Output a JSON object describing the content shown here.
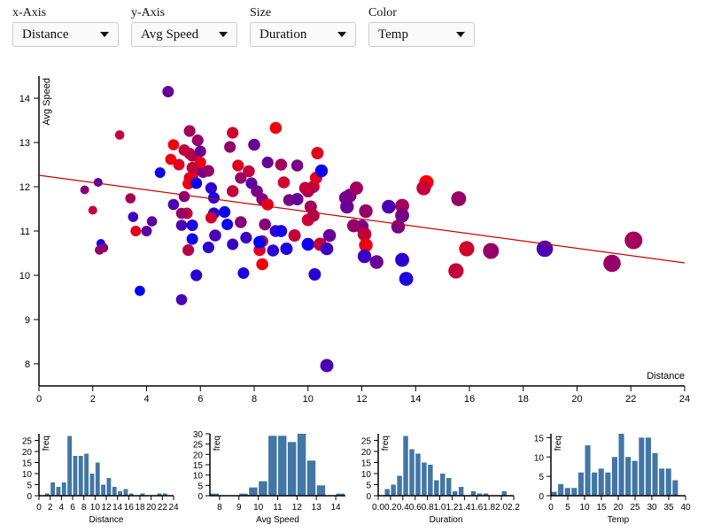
{
  "controls": [
    {
      "label": "x-Axis",
      "value": "Distance"
    },
    {
      "label": "y-Axis",
      "value": "Avg Speed"
    },
    {
      "label": "Size",
      "value": "Duration"
    },
    {
      "label": "Color",
      "value": "Temp"
    }
  ],
  "colors": {
    "cold": "#0000ff",
    "hot": "#ff0000",
    "regression": "#cc0000",
    "bar": "#4176a5",
    "axis": "#000000"
  },
  "chart_data": [
    {
      "type": "scatter",
      "title": "",
      "xlabel": "Distance",
      "ylabel": "Avg Speed",
      "xlim": [
        0,
        24
      ],
      "ylim": [
        7.5,
        14.5
      ],
      "xticks": [
        0,
        2,
        4,
        6,
        8,
        10,
        12,
        14,
        16,
        18,
        20,
        22,
        24
      ],
      "yticks": [
        8,
        9,
        10,
        11,
        12,
        13,
        14
      ],
      "size_field": "Duration",
      "color_field": "Temp",
      "regression": {
        "x": [
          0,
          24
        ],
        "y": [
          12.26,
          10.28
        ]
      },
      "points": [
        [
          4.8,
          14.15,
          0.5,
          18
        ],
        [
          3.0,
          13.17,
          0.25,
          30
        ],
        [
          1.7,
          11.93,
          0.2,
          22
        ],
        [
          2.0,
          11.47,
          0.2,
          30
        ],
        [
          2.2,
          12.1,
          0.2,
          14
        ],
        [
          2.3,
          10.72,
          0.2,
          6
        ],
        [
          2.25,
          10.57,
          0.25,
          24
        ],
        [
          2.4,
          10.62,
          0.25,
          22
        ],
        [
          3.6,
          11.0,
          0.4,
          34
        ],
        [
          4.0,
          11.0,
          0.4,
          16
        ],
        [
          3.4,
          11.74,
          0.35,
          26
        ],
        [
          4.2,
          11.22,
          0.35,
          16
        ],
        [
          3.5,
          11.32,
          0.35,
          12
        ],
        [
          3.75,
          9.65,
          0.35,
          4
        ],
        [
          5.3,
          9.45,
          0.45,
          14
        ],
        [
          4.5,
          12.32,
          0.4,
          6
        ],
        [
          5.0,
          12.95,
          0.45,
          36
        ],
        [
          4.9,
          12.62,
          0.45,
          36
        ],
        [
          5.6,
          12.75,
          0.55,
          30
        ],
        [
          5.6,
          13.26,
          0.55,
          26
        ],
        [
          5.4,
          12.83,
          0.5,
          30
        ],
        [
          5.7,
          12.7,
          0.55,
          28
        ],
        [
          6.0,
          12.8,
          0.5,
          18
        ],
        [
          5.9,
          13.05,
          0.55,
          24
        ],
        [
          6.0,
          12.38,
          0.55,
          20
        ],
        [
          6.1,
          12.33,
          0.5,
          20
        ],
        [
          5.2,
          12.5,
          0.5,
          34
        ],
        [
          5.6,
          12.2,
          0.55,
          32
        ],
        [
          5.7,
          12.23,
          0.55,
          34
        ],
        [
          5.55,
          12.07,
          0.5,
          36
        ],
        [
          5.4,
          11.78,
          0.45,
          22
        ],
        [
          6.3,
          12.36,
          0.55,
          24
        ],
        [
          5.85,
          12.08,
          0.5,
          6
        ],
        [
          6.4,
          11.97,
          0.55,
          10
        ],
        [
          5.5,
          11.4,
          0.5,
          30
        ],
        [
          5.7,
          11.13,
          0.5,
          8
        ],
        [
          5.3,
          11.13,
          0.45,
          14
        ],
        [
          5.7,
          10.82,
          0.5,
          6
        ],
        [
          6.3,
          10.63,
          0.55,
          10
        ],
        [
          6.55,
          10.9,
          0.6,
          14
        ],
        [
          5.85,
          10.0,
          0.55,
          10
        ],
        [
          5.55,
          10.57,
          0.55,
          28
        ],
        [
          5.0,
          11.6,
          0.45,
          14
        ],
        [
          5.3,
          11.4,
          0.45,
          24
        ],
        [
          6.5,
          11.4,
          0.55,
          10
        ],
        [
          7.0,
          11.15,
          0.5,
          6
        ],
        [
          6.9,
          11.43,
          0.55,
          6
        ],
        [
          7.5,
          11.2,
          0.6,
          22
        ],
        [
          7.7,
          10.85,
          0.55,
          12
        ],
        [
          7.2,
          10.7,
          0.5,
          12
        ],
        [
          7.6,
          10.05,
          0.5,
          8
        ],
        [
          6.5,
          11.75,
          0.5,
          8
        ],
        [
          7.2,
          11.9,
          0.6,
          30
        ],
        [
          7.5,
          12.2,
          0.55,
          24
        ],
        [
          7.9,
          12.08,
          0.55,
          16
        ],
        [
          8.1,
          11.9,
          0.6,
          20
        ],
        [
          8.3,
          11.72,
          0.6,
          22
        ],
        [
          7.4,
          12.48,
          0.55,
          34
        ],
        [
          7.8,
          12.35,
          0.6,
          30
        ],
        [
          8.5,
          12.55,
          0.55,
          18
        ],
        [
          8.0,
          12.95,
          0.6,
          18
        ],
        [
          7.2,
          13.22,
          0.55,
          32
        ],
        [
          8.8,
          13.33,
          0.6,
          36
        ],
        [
          9.0,
          12.5,
          0.6,
          26
        ],
        [
          9.6,
          12.48,
          0.6,
          20
        ],
        [
          9.1,
          12.1,
          0.6,
          32
        ],
        [
          8.5,
          11.6,
          0.6,
          34
        ],
        [
          9.3,
          11.7,
          0.6,
          20
        ],
        [
          9.6,
          11.72,
          0.65,
          18
        ],
        [
          8.4,
          11.15,
          0.6,
          22
        ],
        [
          8.8,
          11.0,
          0.6,
          10
        ],
        [
          9.0,
          11.0,
          0.6,
          20
        ],
        [
          9.5,
          10.9,
          0.65,
          30
        ],
        [
          10.0,
          11.25,
          0.65,
          32
        ],
        [
          10.1,
          11.55,
          0.65,
          26
        ],
        [
          10.2,
          12.0,
          0.65,
          30
        ],
        [
          10.3,
          12.2,
          0.65,
          34
        ],
        [
          10.5,
          12.36,
          0.7,
          6
        ],
        [
          10.35,
          12.76,
          0.65,
          34
        ],
        [
          10.0,
          11.9,
          0.65,
          26
        ],
        [
          8.3,
          10.25,
          0.6,
          36
        ],
        [
          8.2,
          10.57,
          0.6,
          34
        ],
        [
          8.3,
          10.77,
          0.6,
          30
        ],
        [
          8.2,
          10.75,
          0.65,
          4
        ],
        [
          9.2,
          10.6,
          0.65,
          8
        ],
        [
          8.7,
          10.56,
          0.6,
          10
        ],
        [
          9.0,
          11.0,
          0.6,
          6
        ],
        [
          10.25,
          10.02,
          0.65,
          10
        ],
        [
          10.0,
          10.7,
          0.7,
          6
        ],
        [
          10.45,
          10.7,
          0.8,
          30
        ],
        [
          10.7,
          10.6,
          0.75,
          12
        ],
        [
          10.8,
          10.9,
          0.75,
          18
        ],
        [
          10.7,
          7.96,
          0.8,
          14
        ],
        [
          11.4,
          11.75,
          0.8,
          20
        ],
        [
          11.45,
          11.55,
          0.85,
          18
        ],
        [
          11.55,
          11.8,
          0.85,
          20
        ],
        [
          11.8,
          11.97,
          0.8,
          26
        ],
        [
          12.15,
          11.45,
          0.85,
          24
        ],
        [
          12.0,
          11.1,
          0.85,
          20
        ],
        [
          12.1,
          10.93,
          0.9,
          30
        ],
        [
          12.15,
          10.68,
          0.85,
          36
        ],
        [
          12.1,
          10.43,
          0.85,
          12
        ],
        [
          12.55,
          10.3,
          0.85,
          18
        ],
        [
          13.0,
          11.55,
          0.9,
          14
        ],
        [
          13.35,
          11.1,
          0.9,
          20
        ],
        [
          13.5,
          11.57,
          0.95,
          26
        ],
        [
          13.5,
          11.35,
          0.95,
          20
        ],
        [
          13.5,
          10.35,
          0.95,
          10
        ],
        [
          13.65,
          9.92,
          0.95,
          8
        ],
        [
          14.4,
          12.1,
          1.0,
          38
        ],
        [
          14.3,
          11.97,
          1.0,
          30
        ],
        [
          15.5,
          10.1,
          1.2,
          30
        ],
        [
          15.9,
          10.6,
          1.2,
          32
        ],
        [
          15.6,
          11.73,
          1.1,
          24
        ],
        [
          16.8,
          10.55,
          1.35,
          24
        ],
        [
          18.8,
          10.6,
          1.5,
          14
        ],
        [
          21.3,
          10.27,
          1.7,
          24
        ],
        [
          22.1,
          10.79,
          1.8,
          26
        ],
        [
          6.4,
          11.3,
          0.5,
          32
        ],
        [
          6.0,
          12.55,
          0.5,
          36
        ],
        [
          5.7,
          12.43,
          0.55,
          30
        ],
        [
          7.1,
          12.9,
          0.55,
          24
        ],
        [
          10.2,
          11.35,
          0.65,
          28
        ],
        [
          9.9,
          11.97,
          0.65,
          30
        ],
        [
          11.7,
          11.12,
          0.8,
          24
        ]
      ]
    },
    {
      "type": "bar",
      "title": "",
      "xlabel": "Distance",
      "ylabel": "freq",
      "bin_start": 0,
      "bin_width": 1,
      "xlim": [
        0,
        24
      ],
      "ylim": [
        0,
        28
      ],
      "xticks": [
        0,
        2,
        4,
        6,
        8,
        10,
        12,
        14,
        16,
        18,
        20,
        22,
        24
      ],
      "yticks": [
        0,
        5,
        10,
        15,
        20,
        25
      ],
      "values": [
        0,
        1,
        6,
        4,
        6,
        27,
        18,
        18,
        19,
        10,
        15,
        5,
        8,
        4,
        2,
        3,
        1,
        0,
        1,
        0,
        0,
        1,
        1,
        0
      ]
    },
    {
      "type": "bar",
      "title": "",
      "xlabel": "Avg Speed",
      "ylabel": "freq",
      "bin_start": 7.5,
      "bin_width": 0.5,
      "xlim": [
        7.5,
        14.5
      ],
      "ylim": [
        0,
        30
      ],
      "xticks": [
        8,
        9,
        10,
        11,
        12,
        13,
        14
      ],
      "yticks": [
        0,
        5,
        10,
        15,
        20,
        25,
        30
      ],
      "values": [
        1,
        0,
        0,
        1,
        4,
        7,
        29,
        29,
        26,
        30,
        17,
        5,
        0,
        1
      ]
    },
    {
      "type": "bar",
      "title": "",
      "xlabel": "Duration",
      "ylabel": "freq",
      "bin_start": 0,
      "bin_width": 0.1,
      "xlim": [
        0,
        2.2
      ],
      "ylim": [
        0,
        28
      ],
      "xticks": [
        0.0,
        0.2,
        0.4,
        0.6,
        0.8,
        1.0,
        1.2,
        1.4,
        1.6,
        1.8,
        2.0,
        2.2
      ],
      "xtick_labels": [
        "0.0",
        "0.2",
        "0.4",
        "0.6",
        "0.8",
        "1.0",
        "1.2",
        "1.4",
        "1.6",
        "1.8",
        "2.0",
        "2.2"
      ],
      "yticks": [
        0,
        5,
        10,
        15,
        20,
        25
      ],
      "values": [
        0,
        3,
        5,
        9,
        27,
        21,
        19,
        15,
        14,
        7,
        10,
        8,
        2,
        4,
        0,
        2,
        1,
        1,
        0,
        0,
        2,
        0
      ]
    },
    {
      "type": "bar",
      "title": "",
      "xlabel": "Temp",
      "ylabel": "freq",
      "bin_start": 0,
      "bin_width": 2,
      "xlim": [
        0,
        40
      ],
      "ylim": [
        0,
        16
      ],
      "xticks": [
        0,
        5,
        10,
        15,
        20,
        25,
        30,
        35,
        40
      ],
      "yticks": [
        0,
        5,
        10,
        15
      ],
      "values": [
        1,
        3,
        2,
        2,
        6,
        13,
        6,
        7,
        6,
        10,
        16,
        10,
        9,
        15,
        15,
        11,
        7,
        7,
        4,
        0
      ]
    }
  ]
}
